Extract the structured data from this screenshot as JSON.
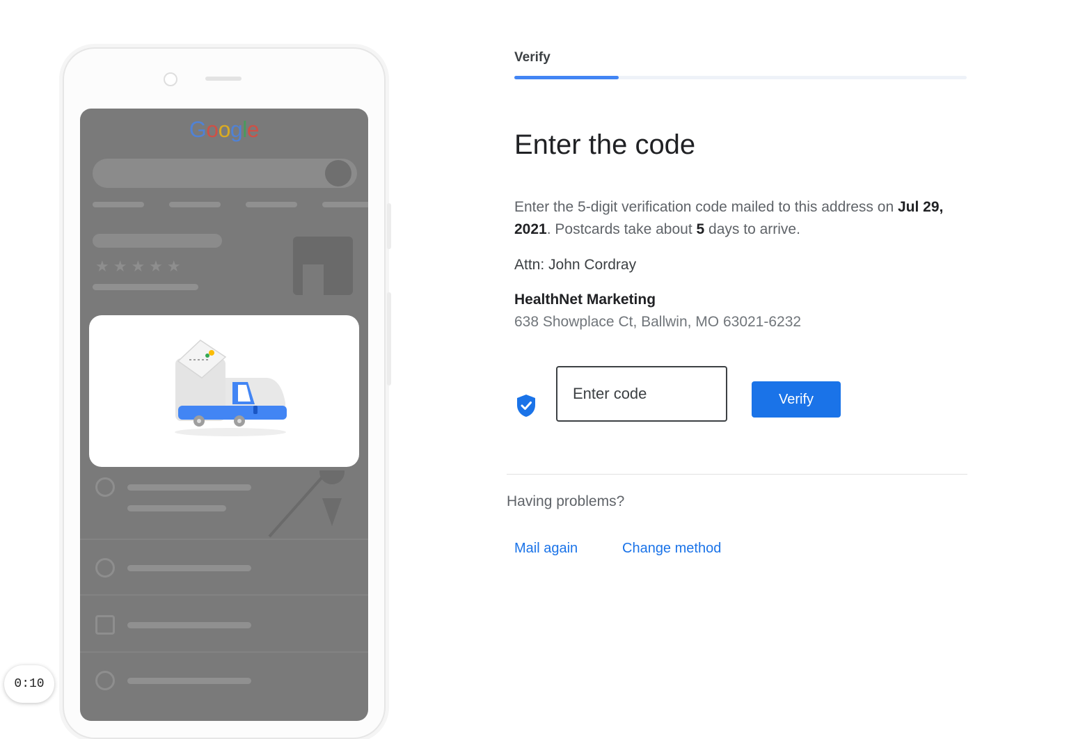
{
  "phone": {
    "logo_letters": [
      {
        "char": "G",
        "color": "#4285f4"
      },
      {
        "char": "o",
        "color": "#ea4335"
      },
      {
        "char": "o",
        "color": "#fbbc05"
      },
      {
        "char": "g",
        "color": "#4285f4"
      },
      {
        "char": "l",
        "color": "#34a853"
      },
      {
        "char": "e",
        "color": "#ea4335"
      }
    ],
    "dialog_icon": "mail-truck-illustration"
  },
  "timer": {
    "text": "0:10"
  },
  "stepper": {
    "label": "Verify",
    "progress_percent": 23
  },
  "main": {
    "title": "Enter the code",
    "description_part1": "Enter the 5-digit verification code mailed to this address on ",
    "description_date": "Jul 29, 2021",
    "description_part2": ". Postcards take about ",
    "description_days": "5",
    "description_part3": " days to arrive.",
    "attn": "Attn: John Cordray",
    "business_name": "HealthNet Marketing",
    "business_address": "638 Showplace Ct, Ballwin, MO 63021-6232",
    "code_input": {
      "placeholder": "Enter code",
      "value": ""
    },
    "verify_button": "Verify",
    "shield_icon": "verified-shield-icon",
    "problems_label": "Having problems?",
    "links": {
      "mail_again": "Mail again",
      "change_method": "Change method"
    }
  },
  "colors": {
    "accent": "#1a73e8",
    "progress": "#4285f4",
    "text_dark": "#202124",
    "text_muted": "#5f6368"
  }
}
